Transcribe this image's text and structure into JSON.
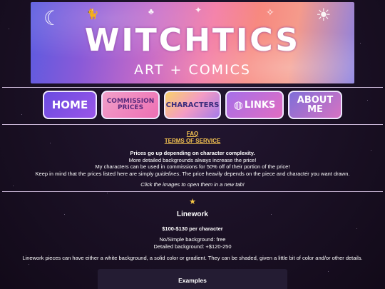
{
  "banner": {
    "title": "WITCHTICS",
    "subtitle": "ART + COMICS",
    "colors": {
      "left": "#5a5be0",
      "center": "#f37ca6",
      "right": "#8a80e2"
    }
  },
  "nav": {
    "home": "HOME",
    "commission_prices": "COMMISSION PRICES",
    "characters": "CHARACTERS",
    "links": "LINKS",
    "about_me": "ABOUT ME"
  },
  "links": {
    "faq": "FAQ",
    "tos": "TERMS OF SERVICE",
    "color": "#f5c451"
  },
  "info": {
    "line1": "Prices go up depending on character complexity.",
    "line2": "More detailed backgrounds always increase the price!",
    "line3": "My characters can be used in commissions for 50% off of their portion of the price!",
    "line4_before": "Keep in mind that the prices listed here are simply ",
    "line4_em": "guidelines",
    "line4_after": ". The price heavily depends on the piece and character you want drawn.",
    "line5": "Click the images to open them in a new tab!"
  },
  "linework": {
    "star": "★",
    "title": "Linework",
    "price": "$100-$130 per character",
    "bg_simple": "No/Simple background: free",
    "bg_detailed": "Detailed background: +$120-250",
    "description": "Linework pieces can have either a white background, a solid color or gradient. They can be shaded, given a little bit of color and/or other details."
  },
  "examples": {
    "title": "Examples"
  },
  "icons": [
    "moon-icon",
    "cat-icon",
    "mushroom-icon",
    "sun-icon",
    "wand-icon",
    "star-icon"
  ]
}
